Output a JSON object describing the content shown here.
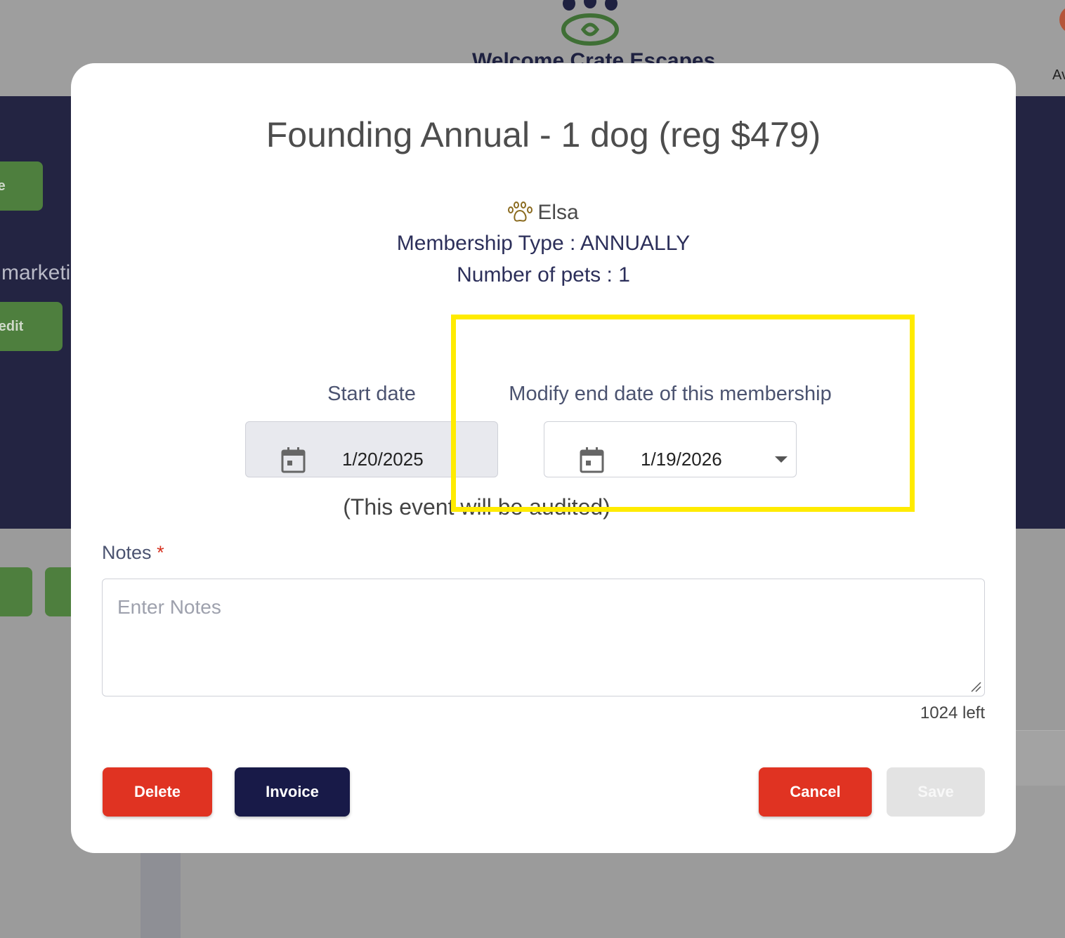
{
  "background": {
    "brand": "Welcome Crate Escapes",
    "user_initial": "Av",
    "left_buttons": [
      "te",
      "redit"
    ],
    "left_text": "marketi",
    "colors": {
      "overlay": "#9b9b9b",
      "hero": "#232442",
      "accent_green": "#4e7f3e"
    }
  },
  "modal": {
    "title": "Founding Annual - 1 dog (reg $479)",
    "pet_icon": "paw-icon",
    "pet_name": "Elsa",
    "membership_type": "Membership Type : ANNUALLY",
    "number_of_pets": "Number of pets : 1",
    "start_date": {
      "label": "Start date",
      "value": "1/20/2025",
      "icon": "calendar-icon"
    },
    "end_date": {
      "label": "Modify end date of this membership",
      "value": "1/19/2026",
      "icon": "calendar-icon"
    },
    "audit_note": "(This event will be audited)",
    "notes": {
      "label": "Notes",
      "required_mark": "*",
      "placeholder": "Enter Notes",
      "value": "",
      "counter": "1024 left"
    },
    "buttons": {
      "delete": "Delete",
      "invoice": "Invoice",
      "cancel": "Cancel",
      "save": "Save"
    },
    "colors": {
      "danger": "#e03322",
      "primary_dark": "#181a48",
      "disabled": "#e3e3e3",
      "highlight": "#ffeb00"
    }
  }
}
